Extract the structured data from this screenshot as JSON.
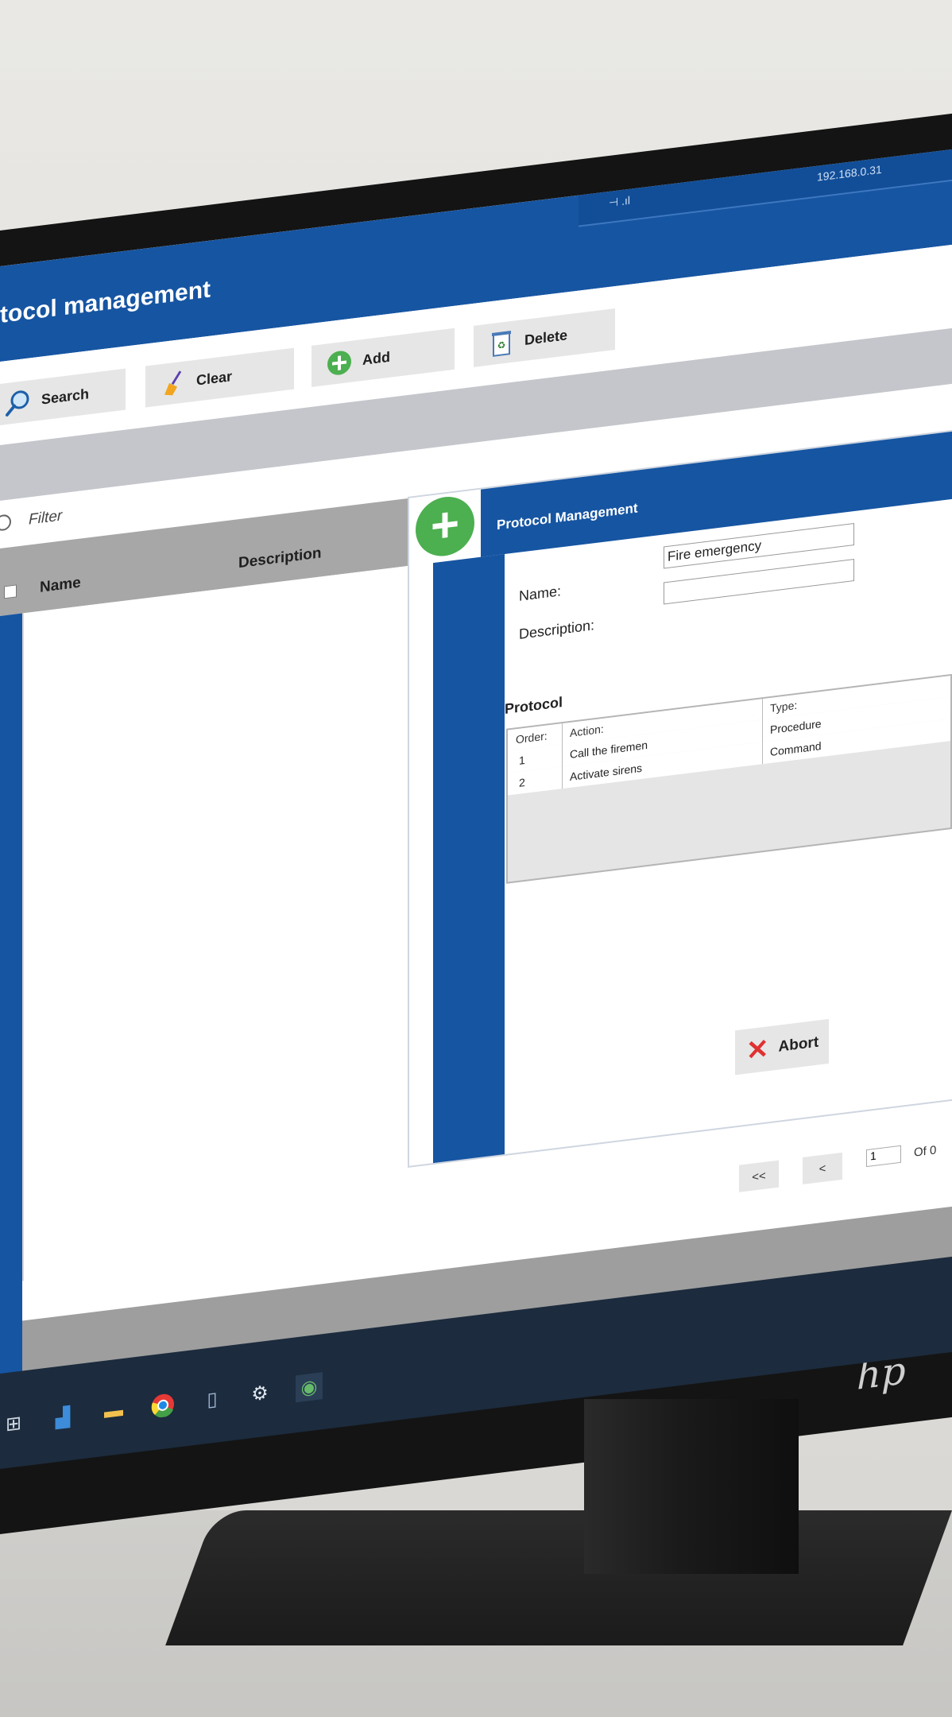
{
  "window": {
    "title": "tocol management",
    "network": {
      "signal": "⊣ .ıl",
      "ip": "192.168.0.31"
    }
  },
  "toolbar": {
    "search_label": "Search",
    "clear_label": "Clear",
    "add_label": "Add",
    "delete_label": "Delete"
  },
  "filter": {
    "label": "Filter"
  },
  "list": {
    "columns": {
      "name": "Name",
      "description": "Description"
    }
  },
  "dialog": {
    "title": "Protocol Management",
    "name_label": "Name:",
    "name_value": "Fire emergency",
    "description_label": "Description:",
    "description_value": "",
    "protocol_section": "Protocol",
    "table": {
      "headers": {
        "order": "Order:",
        "action": "Action:",
        "type": "Type:"
      },
      "rows": [
        {
          "order": "1",
          "action": "Call the firemen",
          "type": "Procedure"
        },
        {
          "order": "2",
          "action": "Activate sirens",
          "type": "Command"
        }
      ]
    },
    "abort_label": "Abort"
  },
  "pager": {
    "first_label": "<<",
    "prev_label": "<",
    "current_page": "1",
    "of_label": "Of 0"
  },
  "brand": {
    "logo_text": "hp"
  },
  "colors": {
    "primary_blue": "#1655a2",
    "add_green": "#4caf50",
    "abort_red": "#e03131"
  }
}
